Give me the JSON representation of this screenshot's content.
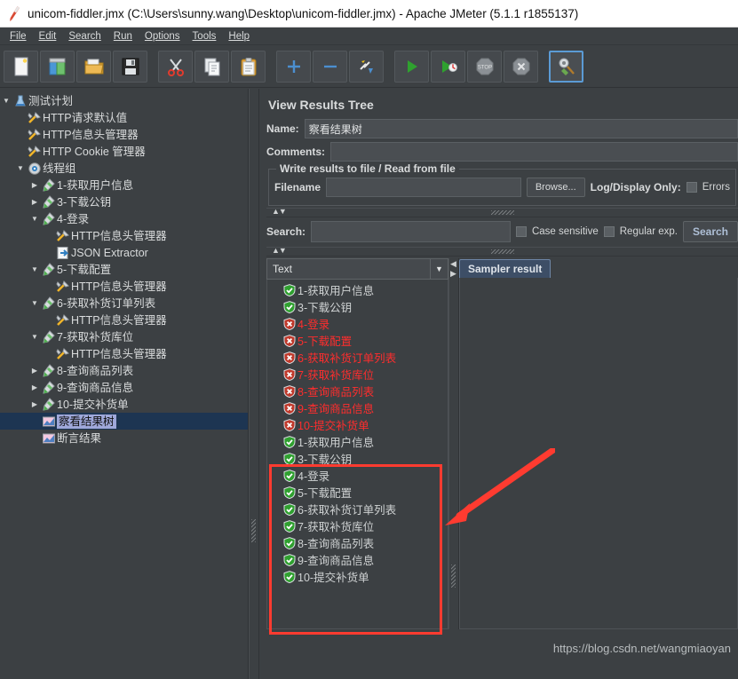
{
  "window": {
    "title": "unicom-fiddler.jmx (C:\\Users\\sunny.wang\\Desktop\\unicom-fiddler.jmx) - Apache JMeter (5.1.1 r1855137)",
    "app_icon": "jmeter-feather-icon"
  },
  "menubar": {
    "items": [
      {
        "label": "File",
        "mnemonic": "F"
      },
      {
        "label": "Edit",
        "mnemonic": "E"
      },
      {
        "label": "Search",
        "mnemonic": "S"
      },
      {
        "label": "Run",
        "mnemonic": "R"
      },
      {
        "label": "Options",
        "mnemonic": "O"
      },
      {
        "label": "Tools",
        "mnemonic": "T"
      },
      {
        "label": "Help",
        "mnemonic": "H"
      }
    ]
  },
  "toolbar": {
    "buttons": [
      {
        "name": "new-button",
        "icon": "new-document-icon"
      },
      {
        "name": "templates-button",
        "icon": "templates-icon"
      },
      {
        "name": "open-button",
        "icon": "open-folder-icon"
      },
      {
        "name": "save-button",
        "icon": "floppy-disk-icon"
      },
      {
        "name": "cut-button",
        "icon": "scissors-icon"
      },
      {
        "name": "copy-button",
        "icon": "copy-pages-icon"
      },
      {
        "name": "paste-button",
        "icon": "clipboard-icon"
      },
      {
        "name": "expand-all-button",
        "icon": "plus-icon"
      },
      {
        "name": "collapse-all-button",
        "icon": "minus-icon"
      },
      {
        "name": "toggle-button",
        "icon": "toggle-lightning-icon"
      },
      {
        "name": "start-button",
        "icon": "green-play-icon"
      },
      {
        "name": "start-no-timers-button",
        "icon": "play-no-timers-icon"
      },
      {
        "name": "stop-button",
        "icon": "stop-sign-icon"
      },
      {
        "name": "shutdown-button",
        "icon": "shutdown-octagon-icon"
      },
      {
        "name": "clear-all-button",
        "icon": "broom-clear-icon",
        "selected": true
      }
    ]
  },
  "tree": {
    "nodes": [
      {
        "label": "测试计划",
        "indent": 0,
        "twisty": "down",
        "icon": "test-plan-icon"
      },
      {
        "label": "HTTP请求默认值",
        "indent": 1,
        "twisty": "",
        "icon": "config-wrench-icon"
      },
      {
        "label": "HTTP信息头管理器",
        "indent": 1,
        "twisty": "",
        "icon": "config-wrench-icon"
      },
      {
        "label": "HTTP Cookie 管理器",
        "indent": 1,
        "twisty": "",
        "icon": "config-wrench-icon"
      },
      {
        "label": "线程组",
        "indent": 1,
        "twisty": "down",
        "icon": "thread-group-gear-icon"
      },
      {
        "label": "1-获取用户信息",
        "indent": 2,
        "twisty": "right",
        "icon": "sampler-pipette-icon"
      },
      {
        "label": "3-下载公钥",
        "indent": 2,
        "twisty": "right",
        "icon": "sampler-pipette-icon"
      },
      {
        "label": "4-登录",
        "indent": 2,
        "twisty": "down",
        "icon": "sampler-pipette-icon"
      },
      {
        "label": "HTTP信息头管理器",
        "indent": 3,
        "twisty": "",
        "icon": "config-wrench-icon"
      },
      {
        "label": "JSON Extractor",
        "indent": 3,
        "twisty": "",
        "icon": "postprocessor-icon"
      },
      {
        "label": "5-下载配置",
        "indent": 2,
        "twisty": "down",
        "icon": "sampler-pipette-icon"
      },
      {
        "label": "HTTP信息头管理器",
        "indent": 3,
        "twisty": "",
        "icon": "config-wrench-icon"
      },
      {
        "label": "6-获取补货订单列表",
        "indent": 2,
        "twisty": "down",
        "icon": "sampler-pipette-icon"
      },
      {
        "label": "HTTP信息头管理器",
        "indent": 3,
        "twisty": "",
        "icon": "config-wrench-icon"
      },
      {
        "label": "7-获取补货库位",
        "indent": 2,
        "twisty": "down",
        "icon": "sampler-pipette-icon"
      },
      {
        "label": "HTTP信息头管理器",
        "indent": 3,
        "twisty": "",
        "icon": "config-wrench-icon"
      },
      {
        "label": "8-查询商品列表",
        "indent": 2,
        "twisty": "right",
        "icon": "sampler-pipette-icon"
      },
      {
        "label": "9-查询商品信息",
        "indent": 2,
        "twisty": "right",
        "icon": "sampler-pipette-icon"
      },
      {
        "label": "10-提交补货单",
        "indent": 2,
        "twisty": "right",
        "icon": "sampler-pipette-icon"
      },
      {
        "label": "察看结果树",
        "indent": 2,
        "twisty": "",
        "icon": "listener-chart-icon",
        "selected": true
      },
      {
        "label": "断言结果",
        "indent": 2,
        "twisty": "",
        "icon": "listener-chart-icon"
      }
    ]
  },
  "panel": {
    "title": "View Results Tree",
    "name_label": "Name:",
    "name_value": "察看结果树",
    "comments_label": "Comments:",
    "comments_value": "",
    "write_group_title": "Write results to file / Read from file",
    "filename_label": "Filename",
    "filename_value": "",
    "filename_placeholder": "",
    "browse_label": "Browse...",
    "log_display_label": "Log/Display Only:",
    "errors_label": "Errors",
    "search_label": "Search:",
    "search_value": "",
    "case_sensitive_label": "Case sensitive",
    "regular_exp_label": "Regular exp.",
    "search_button_label": "Search"
  },
  "results": {
    "renderer_selected": "Text",
    "renderer_options": [
      "Text"
    ],
    "tab_label": "Sampler result",
    "top_list": [
      {
        "label": "1-获取用户信息",
        "status": "ok"
      },
      {
        "label": "3-下载公钥",
        "status": "ok"
      },
      {
        "label": "4-登录",
        "status": "error"
      },
      {
        "label": "5-下载配置",
        "status": "error"
      },
      {
        "label": "6-获取补货订单列表",
        "status": "error"
      },
      {
        "label": "7-获取补货库位",
        "status": "error"
      },
      {
        "label": "8-查询商品列表",
        "status": "error"
      },
      {
        "label": "9-查询商品信息",
        "status": "error"
      },
      {
        "label": "10-提交补货单",
        "status": "error"
      }
    ],
    "highlighted_list": [
      {
        "label": "1-获取用户信息",
        "status": "ok"
      },
      {
        "label": "3-下载公钥",
        "status": "ok"
      },
      {
        "label": "4-登录",
        "status": "ok"
      },
      {
        "label": "5-下载配置",
        "status": "ok"
      },
      {
        "label": "6-获取补货订单列表",
        "status": "ok"
      },
      {
        "label": "7-获取补货库位",
        "status": "ok"
      },
      {
        "label": "8-查询商品列表",
        "status": "ok"
      },
      {
        "label": "9-查询商品信息",
        "status": "ok"
      },
      {
        "label": "10-提交补货单",
        "status": "ok"
      }
    ]
  },
  "annotations": {
    "highlight_color": "#ff3b30",
    "arrow_color": "#ff3b30",
    "watermark": "https://blog.csdn.net/wangmiaoyan"
  },
  "colors": {
    "window_bg": "#3c4043",
    "titlebar_bg": "#ffffff",
    "selection_bg": "#1d3552",
    "label_selection_bg": "#9fa8da",
    "error_text": "#ff2d2d",
    "ok_text": "#cfd2d3",
    "tab_active_bg": "#3d4e66"
  }
}
